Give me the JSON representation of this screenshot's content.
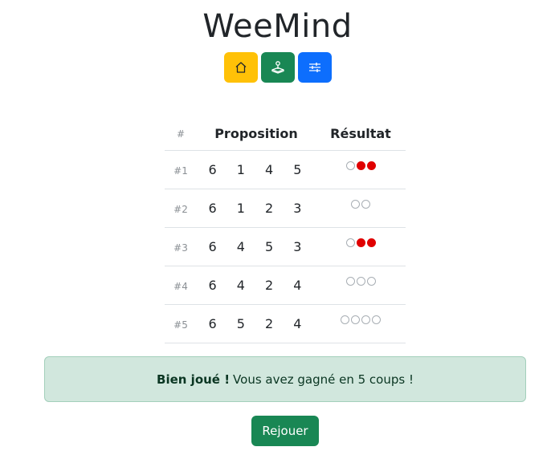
{
  "app": {
    "title": "WeeMind"
  },
  "toolbar": {
    "home": {
      "icon": "home-icon",
      "color": "#ffc107"
    },
    "game": {
      "icon": "joystick-icon",
      "color": "#198754"
    },
    "settings": {
      "icon": "sliders-icon",
      "color": "#0d6efd"
    }
  },
  "table": {
    "headers": {
      "num": "#",
      "proposition": "Proposition",
      "result": "Résultat"
    },
    "rows": [
      {
        "num": "#1",
        "guess": [
          "6",
          "1",
          "4",
          "5"
        ],
        "result": [
          "white",
          "red",
          "red"
        ]
      },
      {
        "num": "#2",
        "guess": [
          "6",
          "1",
          "2",
          "3"
        ],
        "result": [
          "white",
          "white"
        ]
      },
      {
        "num": "#3",
        "guess": [
          "6",
          "4",
          "5",
          "3"
        ],
        "result": [
          "white",
          "red",
          "red"
        ]
      },
      {
        "num": "#4",
        "guess": [
          "6",
          "4",
          "2",
          "4"
        ],
        "result": [
          "white",
          "white",
          "white"
        ]
      },
      {
        "num": "#5",
        "guess": [
          "6",
          "5",
          "2",
          "4"
        ],
        "result": [
          "white",
          "white",
          "white",
          "white"
        ]
      }
    ]
  },
  "alert": {
    "strong": "Bien joué !",
    "text": "Vous avez gagné en 5 coups !"
  },
  "replay_label": "Rejouer",
  "colors": {
    "success": "#198754",
    "warning": "#ffc107",
    "primary": "#0d6efd",
    "peg_red": "#e00000"
  }
}
